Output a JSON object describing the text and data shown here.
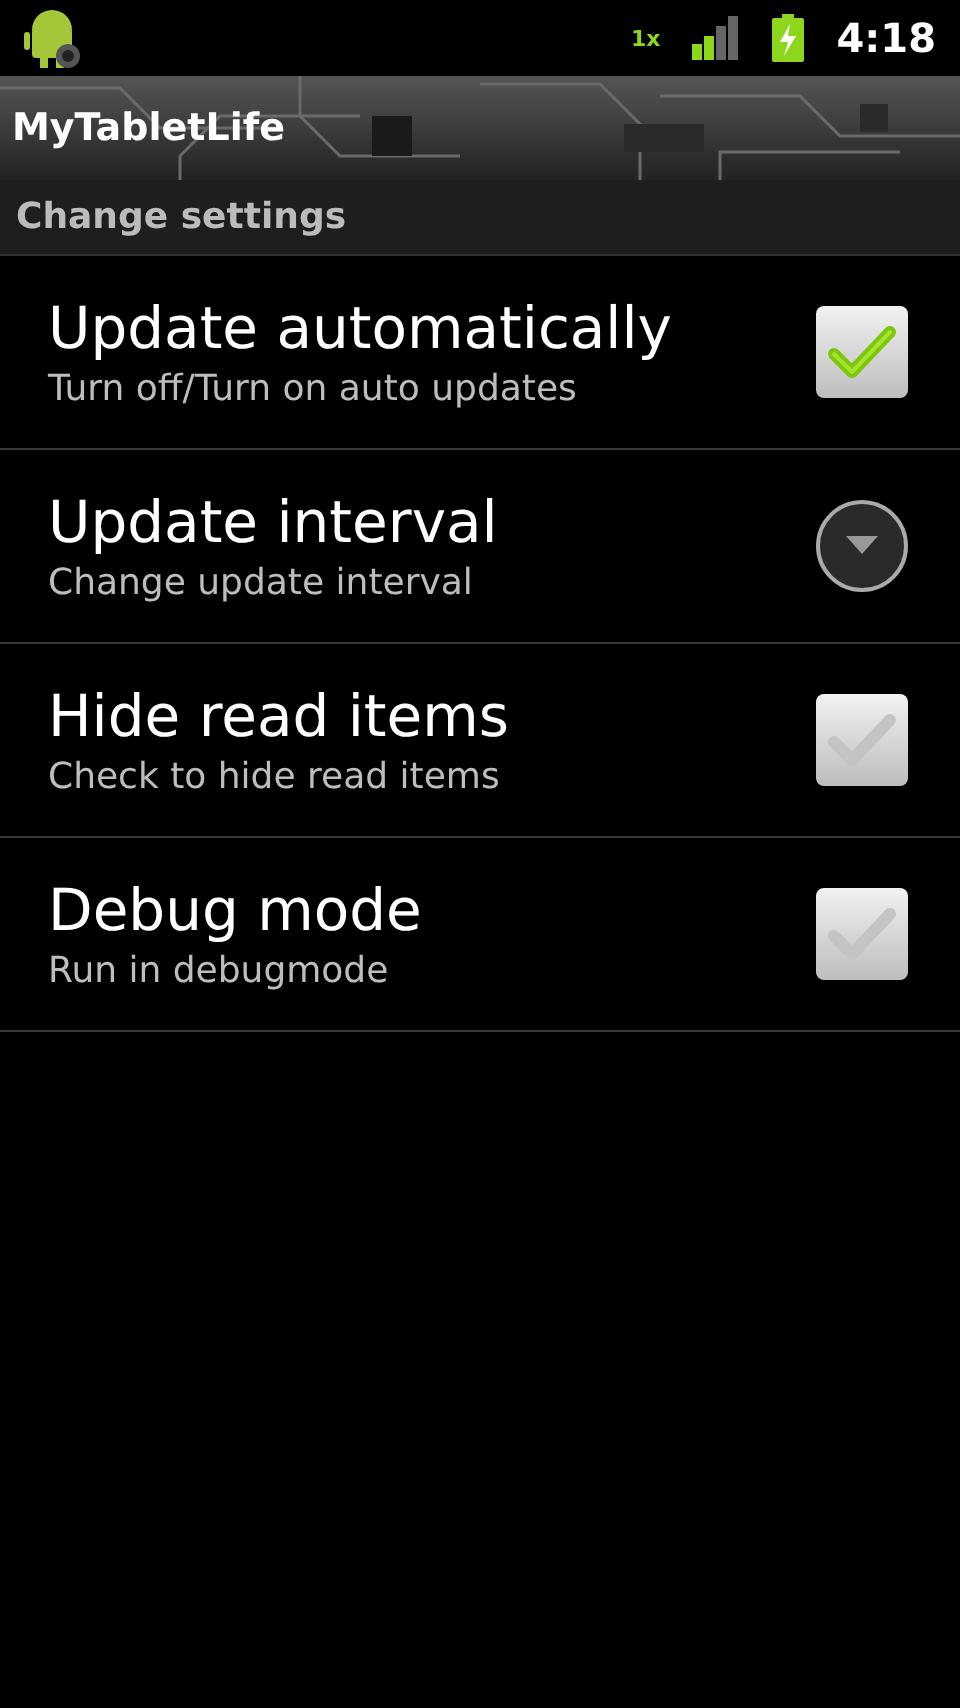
{
  "status_bar": {
    "network": "1x",
    "time": "4:18"
  },
  "title_bar": {
    "title": "MyTabletLife"
  },
  "category": {
    "title": "Change settings"
  },
  "items": [
    {
      "kind": "checkbox",
      "title": "Update automatically",
      "summary": "Turn off/Turn on auto updates",
      "checked": true
    },
    {
      "kind": "dropdown",
      "title": "Update interval",
      "summary": "Change update interval"
    },
    {
      "kind": "checkbox",
      "title": "Hide read items",
      "summary": "Check to hide read items",
      "checked": false
    },
    {
      "kind": "checkbox",
      "title": "Debug mode",
      "summary": "Run in debugmode",
      "checked": false
    }
  ]
}
